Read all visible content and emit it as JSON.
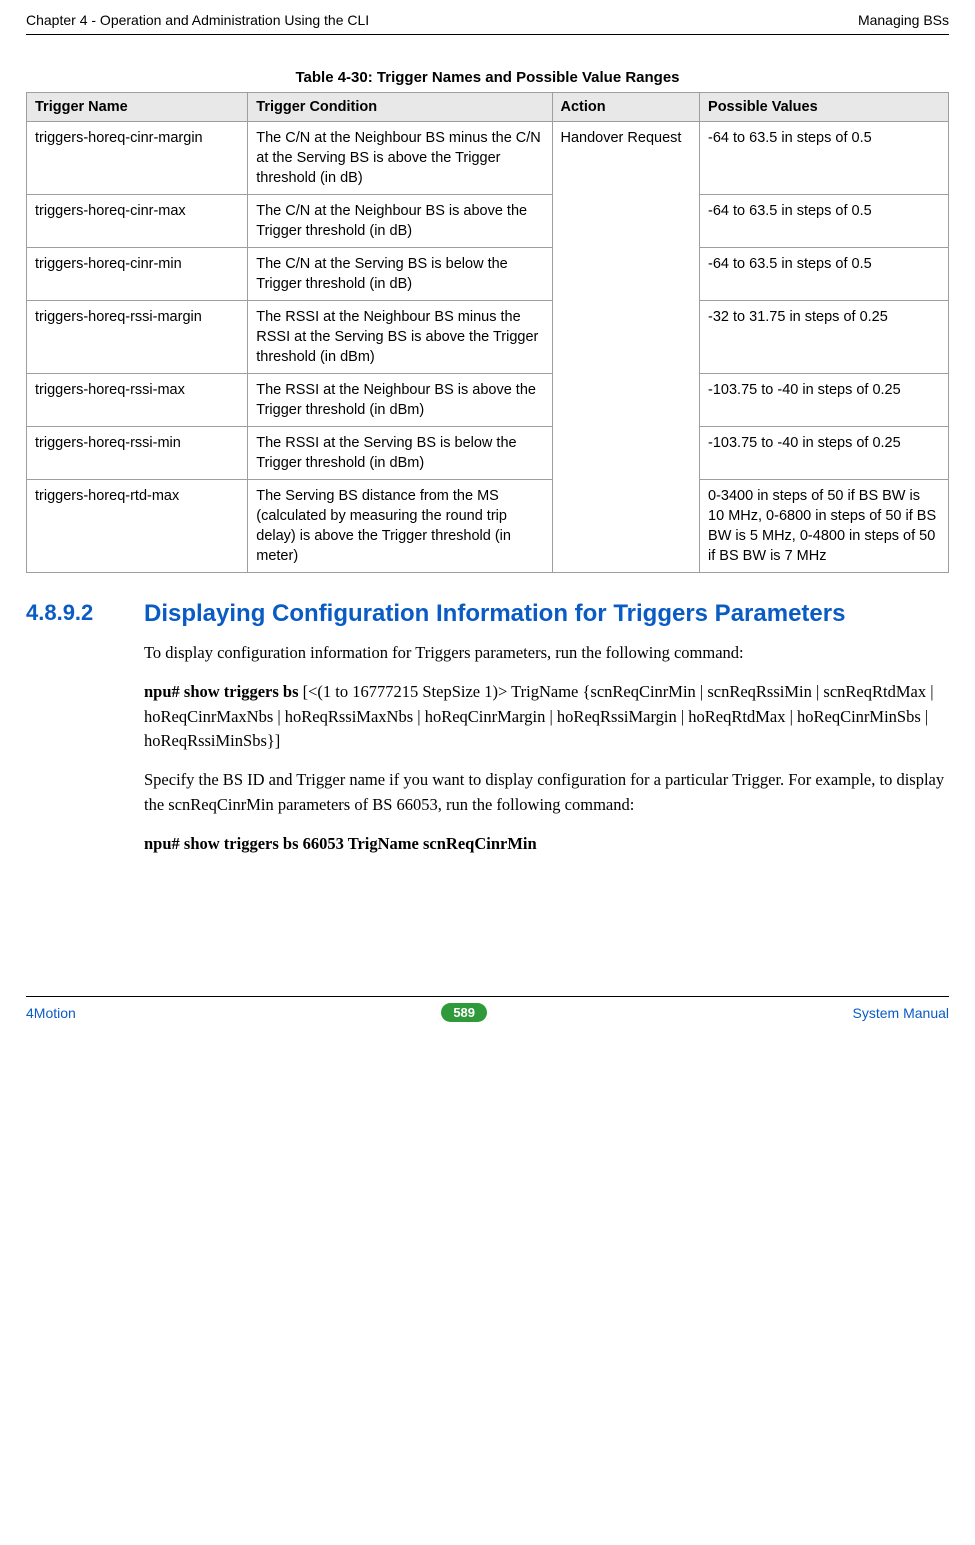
{
  "header": {
    "left": "Chapter 4 - Operation and Administration Using the CLI",
    "right": "Managing BSs"
  },
  "table": {
    "caption": "Table 4-30: Trigger Names and Possible Value Ranges",
    "headers": {
      "c0": "Trigger Name",
      "c1": "Trigger Condition",
      "c2": "Action",
      "c3": "Possible Values"
    },
    "action_cell": "Handover Request",
    "rows": [
      {
        "name": "triggers-horeq-cinr-margin",
        "cond": "The C/N at the Neighbour BS minus the C/N at the Serving BS is above the Trigger threshold (in dB)",
        "vals": "-64 to 63.5 in steps of 0.5"
      },
      {
        "name": "triggers-horeq-cinr-max",
        "cond": "The C/N at the Neighbour BS is above the Trigger threshold (in dB)",
        "vals": "-64 to 63.5 in steps of 0.5"
      },
      {
        "name": "triggers-horeq-cinr-min",
        "cond": "The C/N at the Serving BS is below the Trigger threshold (in dB)",
        "vals": "-64 to 63.5 in steps of 0.5"
      },
      {
        "name": "triggers-horeq-rssi-margin",
        "cond": "The RSSI at the Neighbour BS minus the RSSI at the Serving BS is above the Trigger threshold (in dBm)",
        "vals": "-32 to 31.75 in steps of 0.25"
      },
      {
        "name": "triggers-horeq-rssi-max",
        "cond": "The RSSI at the Neighbour BS is above the Trigger threshold (in dBm)",
        "vals": "-103.75 to -40 in steps of 0.25"
      },
      {
        "name": "triggers-horeq-rssi-min",
        "cond": "The RSSI at the Serving BS is below the Trigger threshold (in dBm)",
        "vals": "-103.75 to -40 in steps of 0.25"
      },
      {
        "name": "triggers-horeq-rtd-max",
        "cond": "The Serving BS distance from the MS  (calculated by measuring the round trip delay) is above the Trigger threshold (in meter)",
        "vals": "0-3400 in steps of 50 if BS BW is 10 MHz, 0-6800 in steps of 50 if BS BW is 5 MHz, 0-4800 in steps of 50 if BS BW is 7 MHz"
      }
    ]
  },
  "section": {
    "number": "4.8.9.2",
    "title": "Displaying Configuration Information for Triggers Parameters"
  },
  "body": {
    "p1": "To display configuration information for Triggers parameters, run the following command:",
    "p2_bold": "npu# show triggers bs ",
    "p2_rest": "[<(1 to 16777215 StepSize 1)> TrigName {scnReqCinrMin | scnReqRssiMin | scnReqRtdMax | hoReqCinrMaxNbs | hoReqRssiMaxNbs | hoReqCinrMargin | hoReqRssiMargin | hoReqRtdMax | hoReqCinrMinSbs | hoReqRssiMinSbs}]",
    "p3": "Specify the BS ID and Trigger name if you want to display configuration for a particular Trigger. For example, to display the scnReqCinrMin parameters of BS 66053, run the following command:",
    "p4": "npu# show triggers bs 66053 TrigName scnReqCinrMin"
  },
  "footer": {
    "left": "4Motion",
    "page": "589",
    "right": "System Manual"
  }
}
